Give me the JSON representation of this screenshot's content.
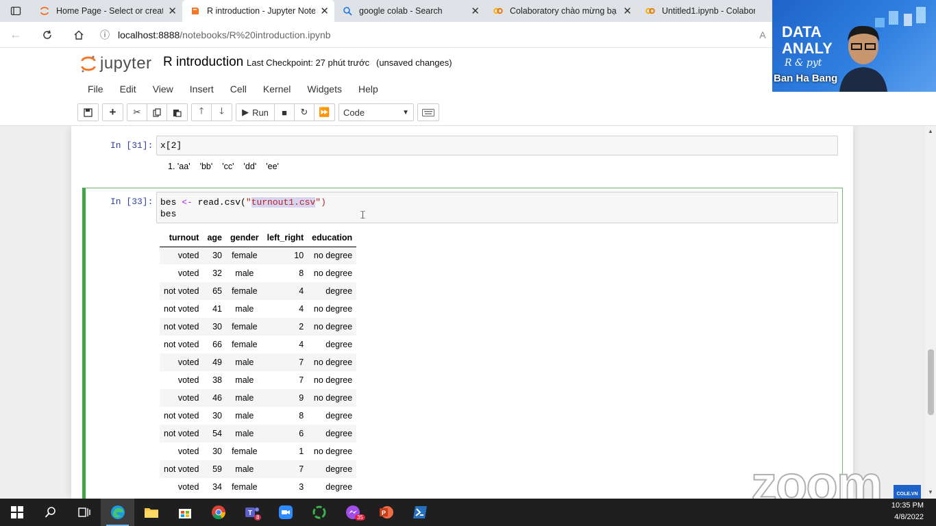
{
  "browser": {
    "tabs": [
      {
        "title": "Home Page - Select or create",
        "favicon": "jupyter-icon",
        "active": false
      },
      {
        "title": "R introduction - Jupyter Note",
        "favicon": "jupyter-book-icon",
        "active": true
      },
      {
        "title": "google colab - Search",
        "favicon": "search-icon",
        "active": false
      },
      {
        "title": "Colaboratory chào mừng bạ",
        "favicon": "colab-icon",
        "active": false
      },
      {
        "title": "Untitled1.ipynb - Colaborato",
        "favicon": "colab-icon",
        "active": false
      }
    ],
    "url_host": "localhost:8888",
    "url_path": "/notebooks/R%20introduction.ipynb"
  },
  "jupyter": {
    "logo_text": "jupyter",
    "notebook_name": "R introduction",
    "checkpoint": "Last Checkpoint: 27 phút trước",
    "unsaved": "(unsaved changes)",
    "menu": [
      "File",
      "Edit",
      "View",
      "Insert",
      "Cell",
      "Kernel",
      "Widgets",
      "Help"
    ],
    "run_label": "Run",
    "cell_type": "Code"
  },
  "cells": {
    "cell1": {
      "prompt": "In [31]:",
      "code": "x[2]",
      "output": [
        "1. 'aa'",
        "'bb'",
        "'cc'",
        "'dd'",
        "'ee'"
      ]
    },
    "cell2": {
      "prompt": "In [33]:",
      "code_pre": "bes ",
      "code_op": "<-",
      "code_mid": " read.csv(",
      "code_quote_open": "\"",
      "code_file": "turnout1.csv",
      "code_quote_close": "\")",
      "code_line2": "bes"
    }
  },
  "dataframe": {
    "columns": [
      "turnout",
      "age",
      "gender",
      "left_right",
      "education"
    ],
    "rows": [
      [
        "voted",
        "30",
        "female",
        "10",
        "no degree"
      ],
      [
        "voted",
        "32",
        "male",
        "8",
        "no degree"
      ],
      [
        "not voted",
        "65",
        "female",
        "4",
        "degree"
      ],
      [
        "not voted",
        "41",
        "male",
        "4",
        "no degree"
      ],
      [
        "not voted",
        "30",
        "female",
        "2",
        "no degree"
      ],
      [
        "not voted",
        "66",
        "female",
        "4",
        "degree"
      ],
      [
        "voted",
        "49",
        "male",
        "7",
        "no degree"
      ],
      [
        "voted",
        "38",
        "male",
        "7",
        "no degree"
      ],
      [
        "voted",
        "46",
        "male",
        "9",
        "no degree"
      ],
      [
        "not voted",
        "30",
        "male",
        "8",
        "degree"
      ],
      [
        "not voted",
        "54",
        "male",
        "6",
        "degree"
      ],
      [
        "voted",
        "30",
        "female",
        "1",
        "no degree"
      ],
      [
        "not voted",
        "59",
        "male",
        "7",
        "degree"
      ],
      [
        "voted",
        "34",
        "female",
        "3",
        "degree"
      ]
    ]
  },
  "zoom": {
    "video_title": "DATA\nANALY",
    "video_subtitle": "R & pyt",
    "participant": "Ban Ha Bang",
    "watermark": "zoom",
    "badge": "COLE.VN"
  },
  "taskbar": {
    "time": "10:35 PM",
    "date": "4/8/2022",
    "teams_badge": "8",
    "messenger_badge": "35"
  },
  "colors": {
    "accent_green": "#42a547",
    "prompt_blue": "#303f9f",
    "jupyter_orange": "#f37726"
  }
}
